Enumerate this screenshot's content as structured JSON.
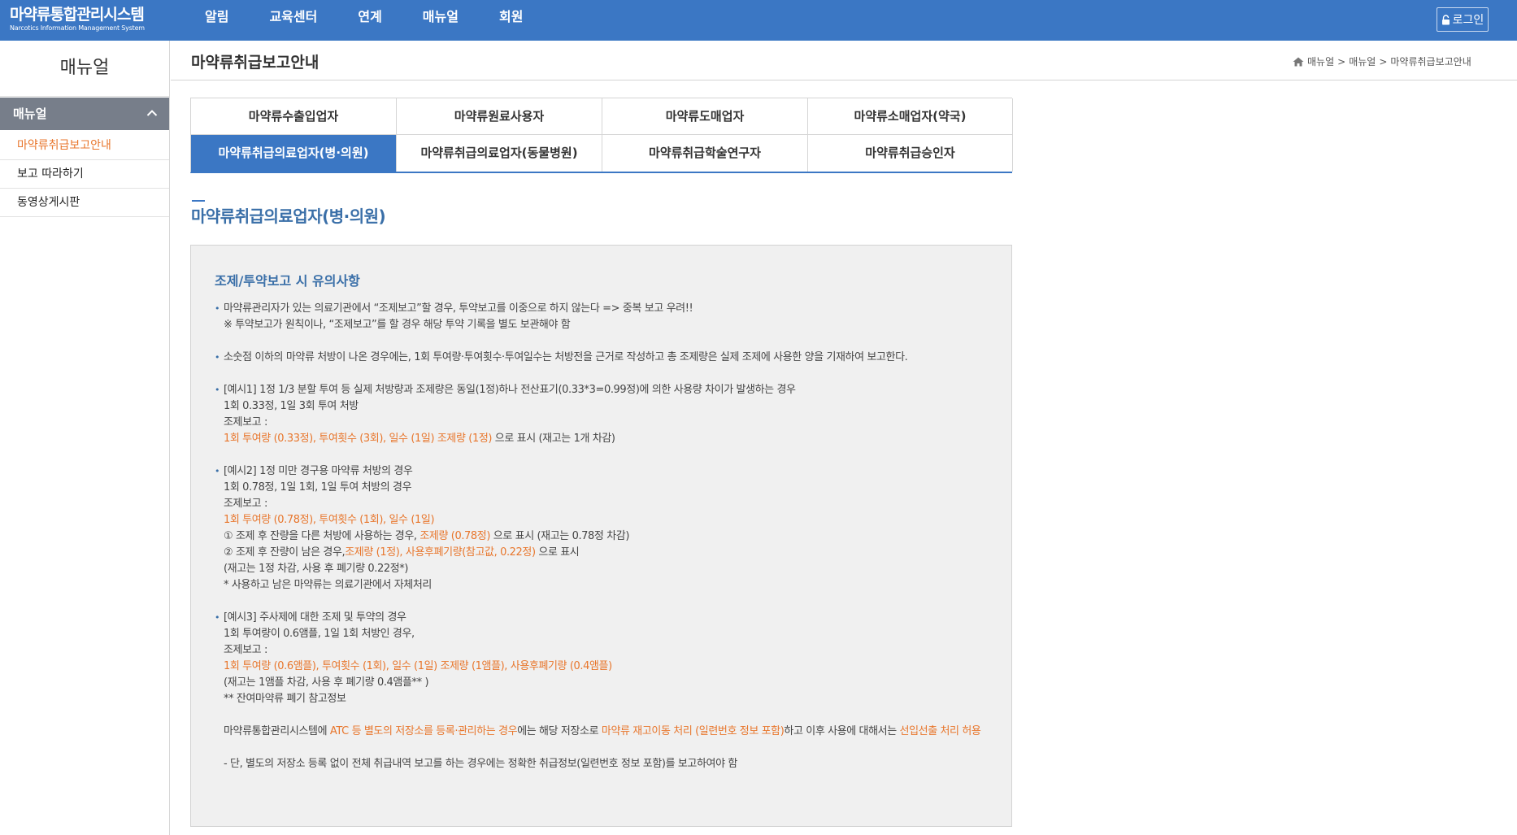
{
  "header": {
    "logo_title": "마약류통합관리시스템",
    "logo_subtitle": "Narcotics Information Management System",
    "nav": [
      "알림",
      "교육센터",
      "연계",
      "매뉴얼",
      "회원"
    ],
    "login_label": "로그인",
    "bg_color": "#3b77c4"
  },
  "sidebar": {
    "title": "매뉴얼",
    "group_label": "매뉴얼",
    "items": [
      {
        "label": "마약류취급보고안내",
        "active": true
      },
      {
        "label": "보고 따라하기",
        "active": false
      },
      {
        "label": "동영상게시판",
        "active": false
      }
    ]
  },
  "page": {
    "title": "마약류취급보고안내",
    "breadcrumb": [
      "매뉴얼",
      "매뉴얼",
      "마약류취급보고안내"
    ],
    "breadcrumb_sep": ">"
  },
  "tabs": [
    "마약류수출입업자",
    "마약류원료사용자",
    "마약류도매업자",
    "마약류소매업자(약국)",
    "마약류취급의료업자(병·의원)",
    "마약류취급의료업자(동물병원)",
    "마약류취급학술연구자",
    "마약류취급승인자"
  ],
  "active_tab_index": 4,
  "section": {
    "title": "마약류취급의료업자(병·의원)"
  },
  "box": {
    "title": "조제/투약보고 시 유의사항",
    "note1": {
      "line1": "마약류관리자가 있는 의료기관에서 “조제보고”할 경우, 투약보고를 이중으로 하지 않는다 => 중복 보고 우려!!",
      "line2": "※ 투약보고가 원칙이나, “조제보고”를 할 경우 해당 투약 기록을 별도 보관해야 함"
    },
    "note2": {
      "line1": "소숫점 이하의 마약류 처방이 나온 경우에는, 1회 투여량·투여횟수·투여일수는 처방전을 근거로 작성하고 총 조제량은 실제 조제에 사용한 양을 기재하여 보고한다."
    },
    "note3": {
      "line1": "[예시1] 1정 1/3 분할 투여 등 실제 처방량과 조제량은 동일(1정)하나 전산표기(0.33*3=0.99정)에 의한 사용량 차이가 발생하는 경우",
      "line2": "1회 0.33정, 1일 3회 투여 처방",
      "line3": "조제보고 :",
      "line4_hl": "1회 투여량 (0.33정), 투여횟수 (3회), 일수 (1일) 조제량 (1정)",
      "line4_rest": " 으로 표시 (재고는 1개 차감)"
    },
    "note4": {
      "line1": "[예시2] 1정 미만 경구용 마약류 처방의 경우",
      "line2": "1회 0.78정, 1일 1회, 1일 투여 처방의 경우",
      "line3": "조제보고 :",
      "line4_hl": "1회 투여량 (0.78정), 투여횟수 (1회), 일수 (1일)",
      "line5_a": "① 조제 후 잔량을 다른 처방에 사용하는 경우, ",
      "line5_hl": "조제량 (0.78정)",
      "line5_b": " 으로 표시 (재고는 0.78정 차감)",
      "line6_a": "② 조제 후 잔량이 남은 경우,",
      "line6_hl": "조제량 (1정), 사용후폐기량(참고값, 0.22정)",
      "line6_b": " 으로 표시",
      "line7": "(재고는 1정 차감, 사용 후 폐기량 0.22정*)",
      "line8": "* 사용하고 남은 마약류는 의료기관에서 자체처리"
    },
    "note5": {
      "line1": "[예시3] 주사제에 대한 조제 및 투약의 경우",
      "line2": "1회 투여량이 0.6앰플, 1일 1회 처방인 경우,",
      "line3": "조제보고 :",
      "line4_hl": "1회 투여량 (0.6앰플), 투여횟수 (1회), 일수 (1일) 조제량 (1앰플), 사용후폐기량 (0.4앰플)",
      "line5": "(재고는 1앰플 차감, 사용 후 폐기량 0.4앰플** )",
      "line6": "** 잔여마약류 폐기 참고정보"
    },
    "para1": {
      "a": "마약류통합관리시스템에 ",
      "hl1": "ATC 등 별도의 저장소를 등록·관리하는 경우",
      "b": "에는 해당 저장소로 ",
      "hl2": "마약류 재고이동 처리 (일련번호 정보 포함)",
      "c": "하고 이후 사용에 대해서는 ",
      "hl3": "선입선출 처리 허용"
    },
    "para2": "- 단, 별도의 저장소 등록 없이 전체 취급내역 보고를 하는 경우에는 정확한 취급정보(일련번호 정보 포함)를 보고하여야 함"
  },
  "colors": {
    "accent": "#3b77c4",
    "highlight": "#e8762c",
    "section_title": "#3a6fa8"
  }
}
